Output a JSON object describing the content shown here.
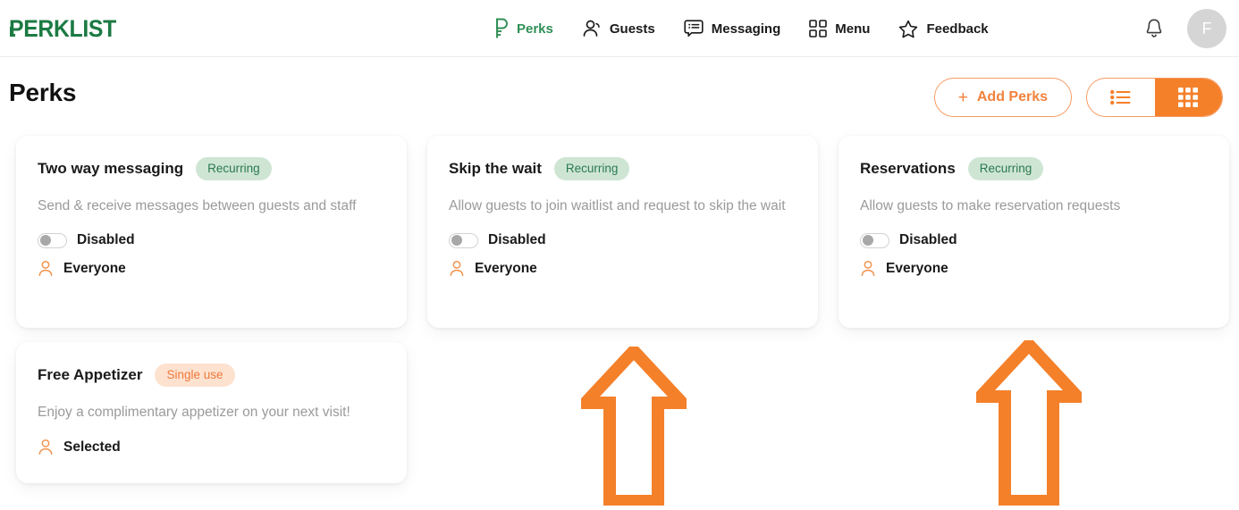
{
  "header": {
    "logo_text": "PERKLIST",
    "nav": [
      {
        "label": "Perks",
        "icon": "key-perks-icon",
        "active": true
      },
      {
        "label": "Guests",
        "icon": "person-icon",
        "active": false
      },
      {
        "label": "Messaging",
        "icon": "message-list-icon",
        "active": false
      },
      {
        "label": "Menu",
        "icon": "grid-2x2-icon",
        "active": false
      },
      {
        "label": "Feedback",
        "icon": "star-icon",
        "active": false
      }
    ],
    "notifications_icon": "bell-icon",
    "avatar_initial": "F"
  },
  "page": {
    "title": "Perks",
    "add_button": {
      "label": "Add Perks",
      "plus": "+"
    },
    "view_toggle": {
      "list_icon": "list-view-icon",
      "grid_icon": "grid-view-icon",
      "active": "grid"
    }
  },
  "cards": [
    {
      "title": "Two way messaging",
      "badge": "Recurring",
      "badge_type": "recurring",
      "description": "Send & receive messages between guests and staff",
      "toggle": {
        "state": "off",
        "label": "Disabled"
      },
      "audience": {
        "icon": "person-icon",
        "label": "Everyone"
      }
    },
    {
      "title": "Skip the wait",
      "badge": "Recurring",
      "badge_type": "recurring",
      "description": "Allow guests to join waitlist and request to skip the wait",
      "toggle": {
        "state": "off",
        "label": "Disabled"
      },
      "audience": {
        "icon": "person-icon",
        "label": "Everyone"
      }
    },
    {
      "title": "Reservations",
      "badge": "Recurring",
      "badge_type": "recurring",
      "description": "Allow guests to make reservation requests",
      "toggle": {
        "state": "off",
        "label": "Disabled"
      },
      "audience": {
        "icon": "person-icon",
        "label": "Everyone"
      }
    },
    {
      "title": "Free Appetizer",
      "badge": "Single use",
      "badge_type": "single",
      "description": "Enjoy a complimentary appetizer on your next visit!",
      "toggle": null,
      "audience": {
        "icon": "person-icon",
        "label": "Selected"
      }
    }
  ],
  "annotations": [
    {
      "name": "up-arrow-annotation-1",
      "icon": "up-arrow-icon"
    },
    {
      "name": "up-arrow-annotation-2",
      "icon": "up-arrow-icon"
    }
  ],
  "colors": {
    "brand_green": "#1c7a43",
    "nav_active_green": "#2f8f56",
    "accent_orange": "#f4802a",
    "badge_green_bg": "#cfe5d4",
    "badge_green_text": "#2a7a4f",
    "badge_orange_bg": "#fde2d0",
    "badge_orange_text": "#f0793b",
    "annotation_orange": "#f4802a"
  }
}
